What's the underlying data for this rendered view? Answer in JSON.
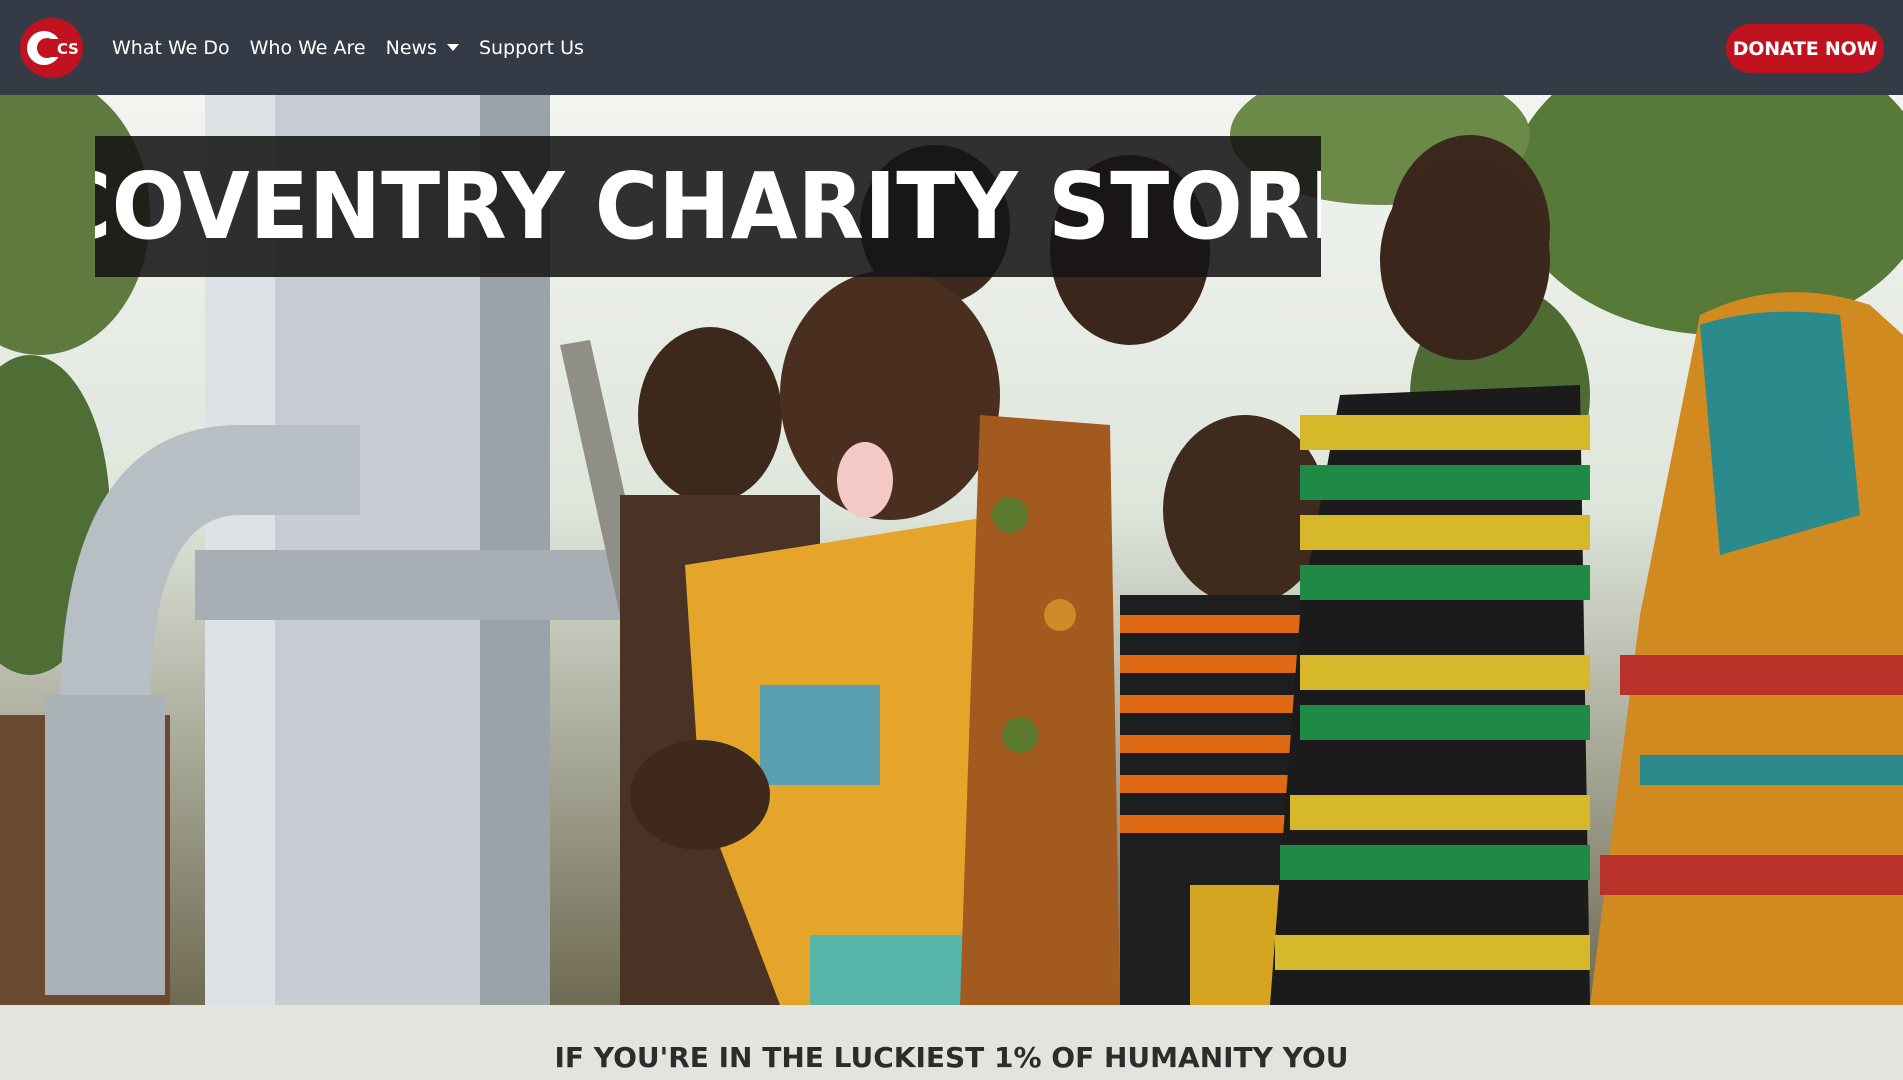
{
  "navbar": {
    "logo_text_c": "C",
    "logo_text_s": "S",
    "links": [
      {
        "label": "What We Do"
      },
      {
        "label": "Who We Are"
      },
      {
        "label": "News",
        "has_dropdown": true
      },
      {
        "label": "Support Us"
      }
    ],
    "donate_label": "DONATE NOW"
  },
  "hero": {
    "title": "COVENTRY CHARITY STORE"
  },
  "tagline": {
    "text": "IF YOU'RE IN THE LUCKIEST 1% OF HUMANITY YOU"
  },
  "colors": {
    "navbar_bg": "#353a47",
    "accent": "#c1121f",
    "title_box_bg": "#141414",
    "page_bg": "#e4e4df"
  },
  "icons": {
    "dropdown": "caret-down-icon",
    "logo": "ccs-logo-icon"
  }
}
